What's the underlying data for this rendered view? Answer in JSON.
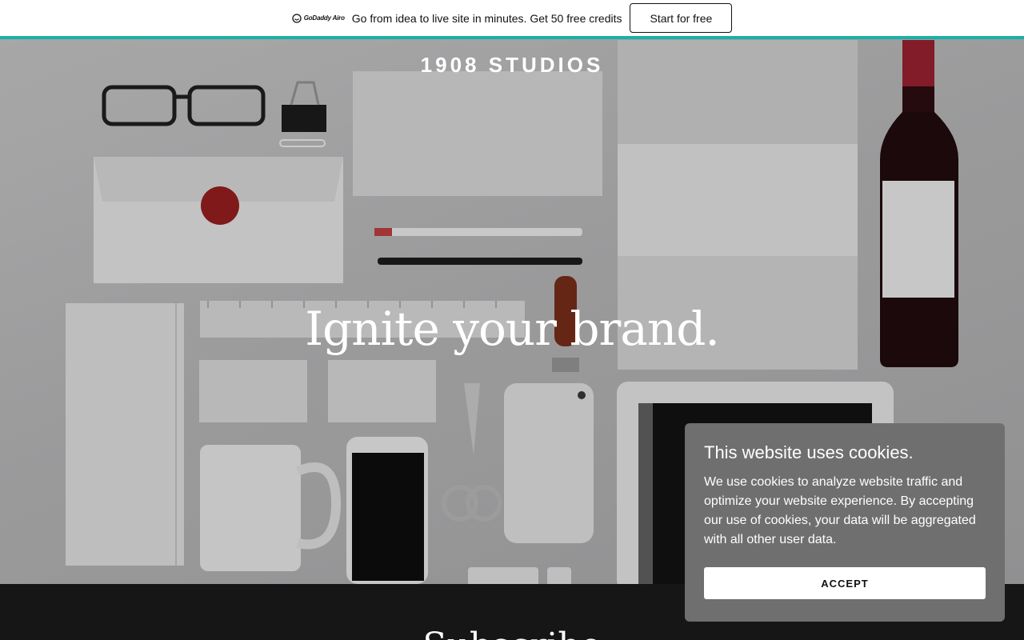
{
  "promo": {
    "logo_text": "GoDaddy Airo",
    "message": "Go from idea to live site in minutes. Get 50 free credits",
    "cta_label": "Start for free"
  },
  "hero": {
    "brand": "1908 STUDIOS",
    "headline": "Ignite your brand."
  },
  "next_section": {
    "title": "Subscribe"
  },
  "cookie": {
    "title": "This website uses cookies.",
    "body": "We use cookies to analyze website traffic and optimize your website experience. By accepting our use of cookies, your data will be aggregated with all other user data.",
    "accept_label": "ACCEPT"
  },
  "colors": {
    "accent_rule": "#1bb0a5",
    "cookie_panel": "#6f6f6f",
    "dark_band": "#161616"
  }
}
